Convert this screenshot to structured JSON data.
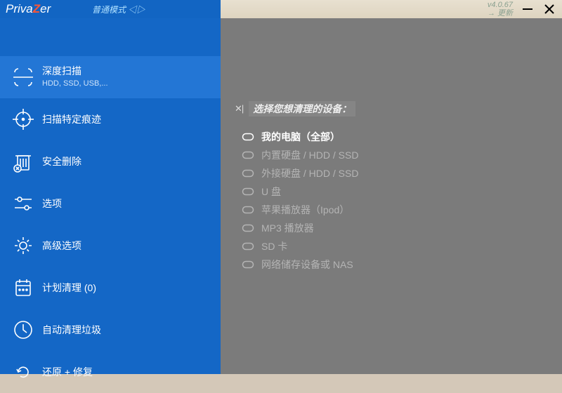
{
  "app": {
    "logo_pre": "Priva",
    "logo_z": "Z",
    "logo_post": "er",
    "mode_label": "普通模式 ◁▷",
    "version": "v4.0.67",
    "update_label": "→ 更新"
  },
  "sidebar": {
    "items": [
      {
        "label": "深度扫描",
        "sub": "HDD, SSD, USB,...",
        "icon": "scan",
        "active": true
      },
      {
        "label": "扫描特定痕迹",
        "sub": "",
        "icon": "target",
        "active": false
      },
      {
        "label": "安全删除",
        "sub": "",
        "icon": "trash",
        "active": false
      },
      {
        "label": "选项",
        "sub": "",
        "icon": "sliders",
        "active": false
      },
      {
        "label": "高级选项",
        "sub": "",
        "icon": "gear",
        "active": false
      },
      {
        "label": "计划清理 (0)",
        "sub": "",
        "icon": "calendar",
        "active": false
      },
      {
        "label": "自动清理垃圾",
        "sub": "",
        "icon": "auto",
        "active": false
      },
      {
        "label": "还原 + 修复",
        "sub": "",
        "icon": "restore",
        "active": false
      }
    ]
  },
  "content": {
    "close": "✕|",
    "title": "选择您想清理的设备：",
    "devices": [
      {
        "label": "我的电脑（全部）",
        "selected": true
      },
      {
        "label": "内置硬盘 / HDD / SSD",
        "selected": false
      },
      {
        "label": "外接硬盘 / HDD / SSD",
        "selected": false
      },
      {
        "label": "U 盘",
        "selected": false
      },
      {
        "label": "苹果播放器（Ipod）",
        "selected": false
      },
      {
        "label": "MP3 播放器",
        "selected": false
      },
      {
        "label": "SD 卡",
        "selected": false
      },
      {
        "label": "网络储存设备或 NAS",
        "selected": false
      }
    ]
  }
}
